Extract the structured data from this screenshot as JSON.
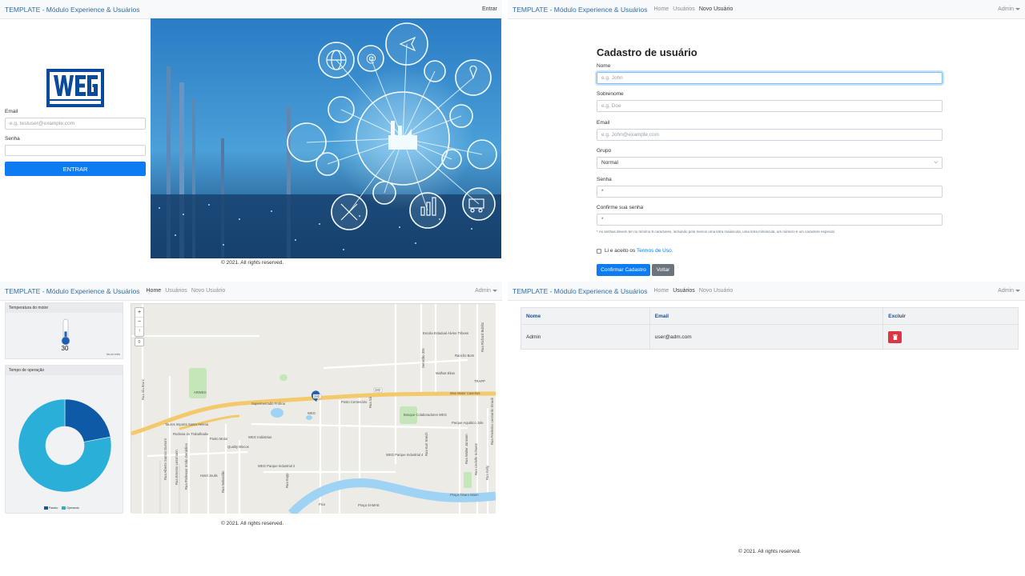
{
  "brand": "TEMPLATE - Módulo Experience & Usuários",
  "footer": "© 2021. All rights reserved.",
  "login": {
    "nav_right": "Entrar",
    "email_label": "Email",
    "email_placeholder": "e.g. testuser@example.com",
    "password_label": "Senha",
    "submit": "ENTRAR"
  },
  "nav": {
    "home": "Home",
    "users": "Usuários",
    "new_user": "Novo Usuário",
    "user_menu": "Admin"
  },
  "register": {
    "title": "Cadastro de usuário",
    "fields": [
      {
        "label": "Nome",
        "placeholder": "e.g. John"
      },
      {
        "label": "Sobrenome",
        "placeholder": "e.g. Doe"
      },
      {
        "label": "Email",
        "placeholder": "e.g. John@example.com"
      },
      {
        "label": "Grupo",
        "value": "Normal"
      },
      {
        "label": "Senha",
        "value": "*"
      },
      {
        "label": "Confirme sua senha",
        "value": "*"
      }
    ],
    "password_hint": "* As senhas devem ter no mínimo 8 caracteres, incluindo pelo menos uma letra maiúscula, uma letra minúscula, um número e um caractere especial.",
    "terms_text": "Li e aceito os",
    "terms_link": "Termos de Uso.",
    "confirm": "Confirmar Cadastro",
    "back": "Voltar"
  },
  "dashboard": {
    "temp_card_title": "Temperatura do motor",
    "temp_value": "30",
    "temp_level": 0.3,
    "temp_caption": "há um mês",
    "op_card_title": "Tempo de operação",
    "chart_data": {
      "type": "pie",
      "title": "Tempo de operação",
      "categories": [
        "Parado",
        "Operando"
      ],
      "values": [
        22,
        78
      ],
      "colors": [
        "#0e5aa7",
        "#2ab0d8"
      ],
      "legend": "bottom"
    }
  },
  "users_table": {
    "headers": [
      "Nome",
      "Email",
      "Excluir"
    ],
    "rows": [
      {
        "name": "Admin",
        "email": "user@adm.com"
      }
    ]
  },
  "map": {
    "labels": [
      "Escola Estadual Alvino Tribess",
      "Rancho Bom",
      "Malhas Elian",
      "Max Motor Caseiros",
      "TRAPP",
      "Supermercado Frohna",
      "Posto Centenário",
      "Tauros Imports Santa Helena",
      "Quality Blocos",
      "Bosque Colaboradores WEG",
      "Parque Aquático Jole",
      "Posto Motor",
      "WEG Indústrias",
      "WEG Parque Industrial 4",
      "WEG Parque Industrial 2",
      "Hotel Joulis",
      "Praça Álvaro Mann",
      "Praça SAMAE",
      "Pico",
      "WEG",
      "ARWEG",
      "Rua Ida Bruni",
      "Rua Alberto Santos Dumont",
      "Rua Ernesto Lessmann",
      "Rua Professor Irmão Geraldino",
      "Rua Sebastião",
      "Rua Richard Bublitz",
      "Rua Kurt Kreich",
      "Servidão 326",
      "Rua Walter Janssen",
      "Rua Lindolfo Schuetz",
      "Rua Kelly",
      "Rua Frederico Leonardo Straub",
      "Rodovia do Trabalhador",
      "Rua Kopp",
      "Rua Sá"
    ],
    "route_numbers": [
      "280",
      "280"
    ]
  }
}
